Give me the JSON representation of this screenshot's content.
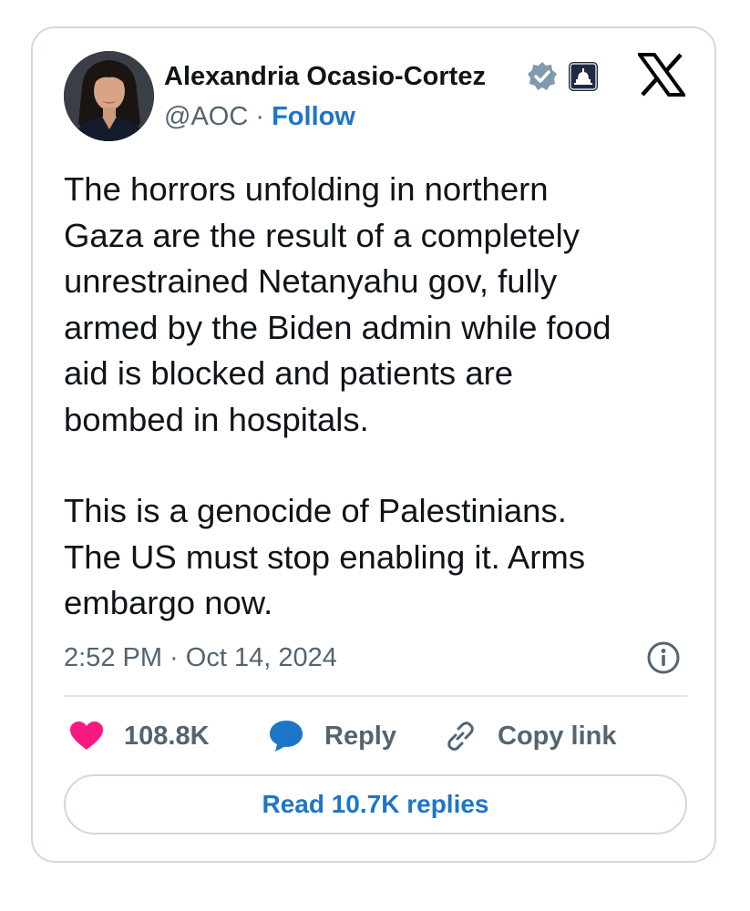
{
  "author": {
    "name": "Alexandria Ocasio-Cortez",
    "handle": "@AOC",
    "separator": "·",
    "follow_label": "Follow"
  },
  "icons": {
    "verified": "verified-badge-icon",
    "affiliation": "capitol-building-icon",
    "brand": "x-logo-icon",
    "info": "info-icon",
    "like": "heart-icon",
    "reply": "speech-bubble-icon",
    "copy": "link-icon"
  },
  "tweet": {
    "paragraph1": [
      "The horrors unfolding in northern",
      "Gaza are the result of a completely",
      "unrestrained Netanyahu gov, fully",
      "armed by the Biden admin while food",
      "aid is blocked and patients are",
      "bombed in hospitals."
    ],
    "paragraph2": [
      "This is a genocide of Palestinians.",
      "The US must stop enabling it. Arms",
      "embargo now."
    ],
    "timestamp": "2:52 PM · Oct 14, 2024"
  },
  "actions": {
    "like_count": "108.8K",
    "reply_label": "Reply",
    "copy_label": "Copy link"
  },
  "read_replies_label": "Read 10.7K replies",
  "colors": {
    "accent": "#1d75c7",
    "like": "#f91880",
    "text": "#0f1419",
    "muted": "#536471",
    "border": "#cfd9de"
  }
}
